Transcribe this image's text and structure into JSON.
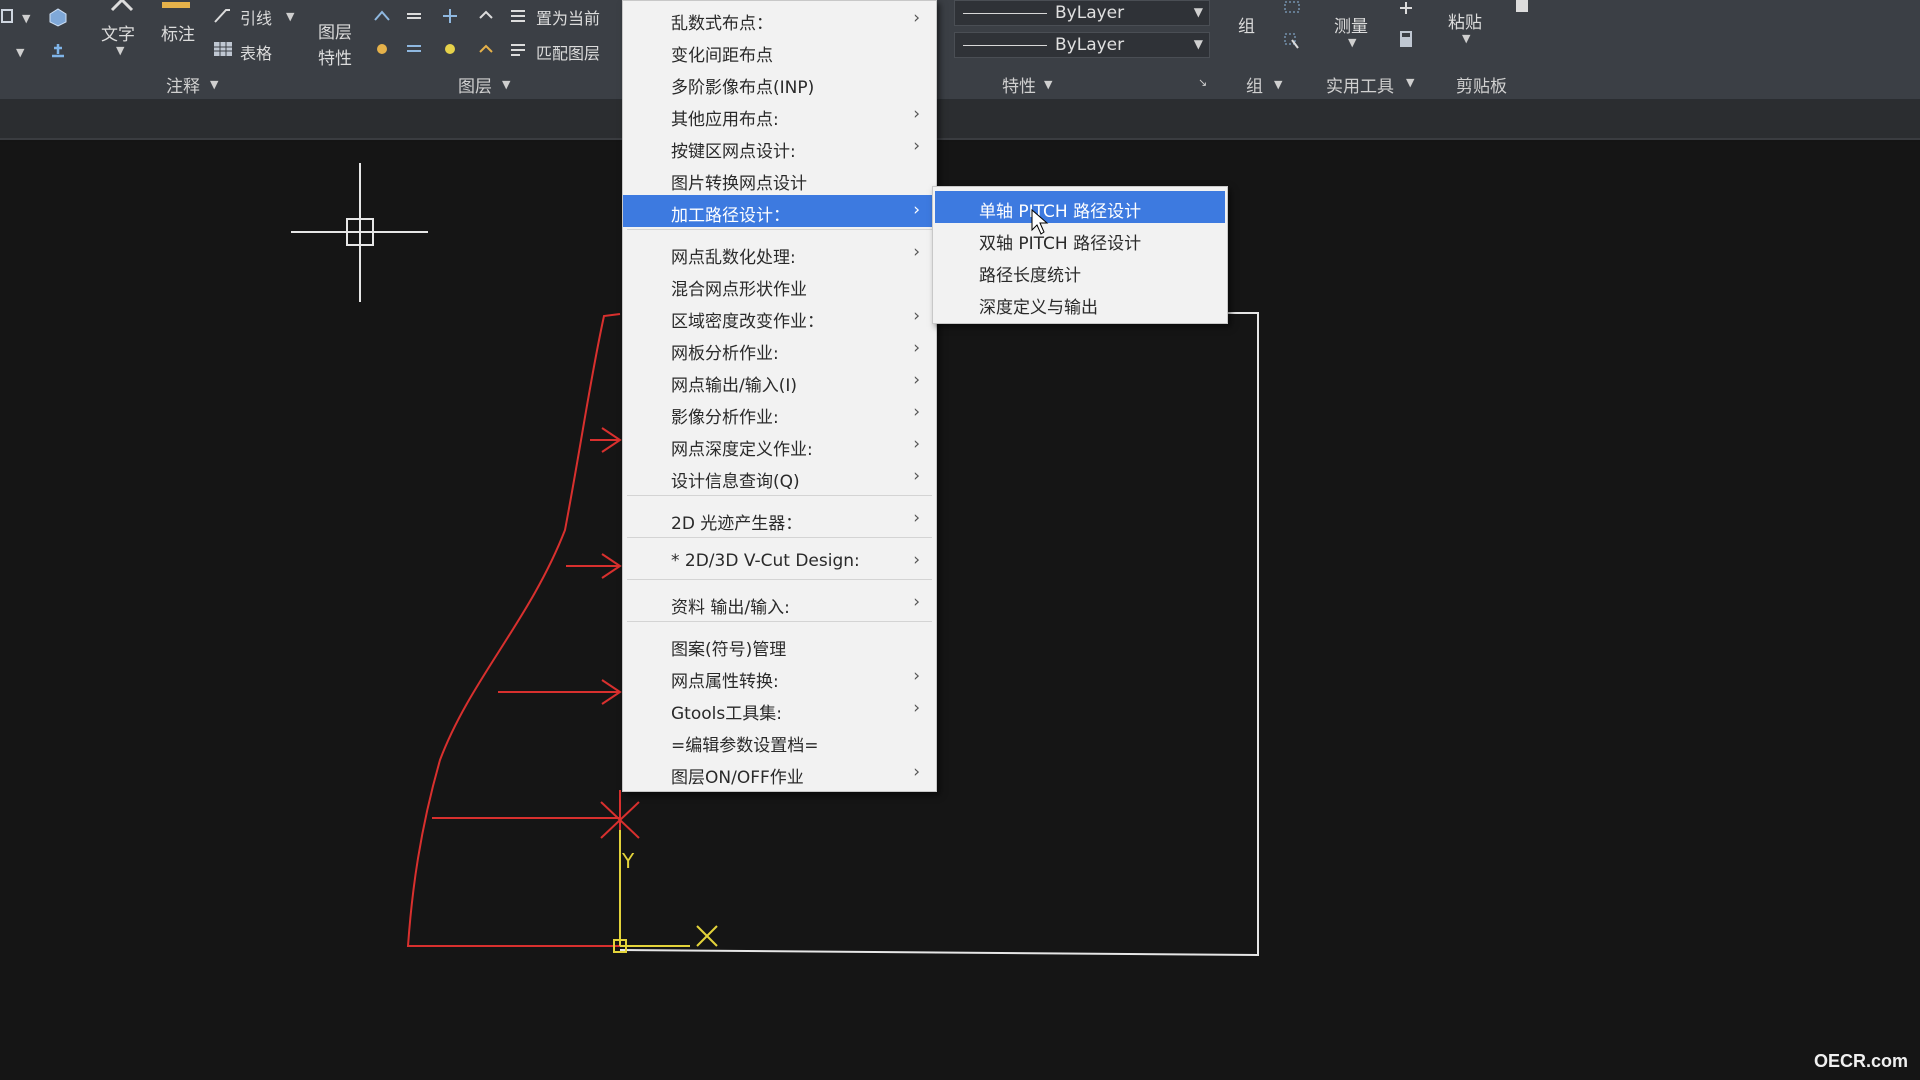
{
  "ribbon": {
    "text_button": "文字",
    "dim_button": "标注",
    "leader_button": "引线",
    "table_button": "表格",
    "layer_props_button_line1": "图层",
    "layer_props_button_line2": "特性",
    "set_current_button": "置为当前",
    "match_layer_button": "匹配图层",
    "annotation_panel": "注释",
    "layers_panel": "图层",
    "properties_panel": "特性",
    "color_value": "ByLayer",
    "linetype_value": "ByLayer",
    "group_button": "组",
    "group_panel": "组",
    "measure_button": "测量",
    "utilities_panel": "实用工具",
    "paste_button": "粘贴",
    "clipboard_panel": "剪贴板"
  },
  "menu": {
    "items": [
      {
        "label": "乱数式布点：",
        "submenu": true
      },
      {
        "label": "变化间距布点",
        "submenu": false
      },
      {
        "label": "多阶影像布点(INP)",
        "submenu": false
      },
      {
        "label": "其他应用布点:",
        "submenu": true
      },
      {
        "label": "按键区网点设计:",
        "submenu": true
      },
      {
        "label": "图片转换网点设计",
        "submenu": false
      },
      {
        "label": "加工路径设计：",
        "submenu": true,
        "active": true
      },
      {
        "label": "网点乱数化处理:",
        "submenu": true
      },
      {
        "label": "混合网点形状作业",
        "submenu": false
      },
      {
        "label": "区域密度改变作业：",
        "submenu": true
      },
      {
        "label": "网板分析作业:",
        "submenu": true
      },
      {
        "label": "网点输出/输入(I)",
        "submenu": true
      },
      {
        "label": "影像分析作业:",
        "submenu": true
      },
      {
        "label": "网点深度定义作业:",
        "submenu": true
      },
      {
        "label": "设计信息查询(Q)",
        "submenu": true
      },
      {
        "label": "2D 光迹产生器：",
        "submenu": true
      },
      {
        "label": "* 2D/3D V-Cut Design:",
        "submenu": true
      },
      {
        "label": "资料 输出/输入:",
        "submenu": true
      },
      {
        "label": "图案(符号)管理",
        "submenu": false
      },
      {
        "label": "网点属性转换:",
        "submenu": true
      },
      {
        "label": "Gtools工具集:",
        "submenu": true
      },
      {
        "label": "=编辑参数设置档=",
        "submenu": false
      },
      {
        "label": "图层ON/OFF作业",
        "submenu": true
      }
    ],
    "arrow_glyph": "›"
  },
  "submenu": {
    "items": [
      {
        "label": "单轴 PITCH 路径设计",
        "active": true
      },
      {
        "label": "双轴 PITCH 路径设计"
      },
      {
        "label": "路径长度统计"
      },
      {
        "label": "深度定义与输出"
      }
    ]
  },
  "drawing": {
    "y_axis_label": "Y",
    "colors": {
      "profile": "#d8302e",
      "ucs": "#e3d33a",
      "outline": "#e6e6e6",
      "highlight": "#3d7ae0"
    }
  },
  "watermark": "OECR.com"
}
